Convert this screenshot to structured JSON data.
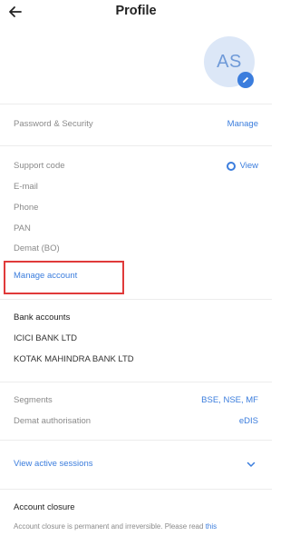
{
  "header": {
    "title": "Profile"
  },
  "avatar": {
    "initials": "AS"
  },
  "security": {
    "label": "Password & Security",
    "action": "Manage"
  },
  "account": {
    "support_code_label": "Support code",
    "support_code_action": "View",
    "email_label": "E-mail",
    "phone_label": "Phone",
    "pan_label": "PAN",
    "demat_label": "Demat (BO)",
    "manage_link": "Manage account"
  },
  "banks": {
    "heading": "Bank accounts",
    "items": [
      "ICICI BANK LTD",
      "KOTAK MAHINDRA BANK LTD"
    ]
  },
  "segments": {
    "label": "Segments",
    "value": "BSE, NSE, MF",
    "demat_auth_label": "Demat authorisation",
    "demat_auth_value": "eDIS"
  },
  "sessions": {
    "label": "View active sessions"
  },
  "closure": {
    "heading": "Account closure",
    "note": "Account closure is permanent and irreversible. Please read",
    "note_link": "this"
  },
  "colors": {
    "accent": "#3b7ddd",
    "avatar_bg": "#dce7f7",
    "highlight": "#e03a3a"
  }
}
